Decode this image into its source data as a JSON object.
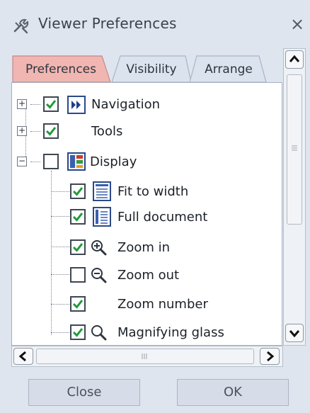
{
  "window": {
    "title": "Viewer Preferences",
    "close_glyph": "×"
  },
  "tabs": [
    {
      "label": "Preferences",
      "active": true
    },
    {
      "label": "Visibility",
      "active": false
    },
    {
      "label": "Arrange",
      "active": false
    }
  ],
  "tree": {
    "items": [
      {
        "label": "Navigation",
        "checked": true,
        "expander": "+",
        "icon": "navigation-icon"
      },
      {
        "label": "Tools",
        "checked": true,
        "expander": "+",
        "icon": ""
      },
      {
        "label": "Display",
        "checked": false,
        "expander": "−",
        "icon": "display-icon"
      },
      {
        "label": "Fit to width",
        "checked": true,
        "icon": "fit-to-width-icon"
      },
      {
        "label": "Full document",
        "checked": true,
        "icon": "full-document-icon"
      },
      {
        "label": "Zoom in",
        "checked": true,
        "icon": "zoom-in-icon"
      },
      {
        "label": "Zoom out",
        "checked": false,
        "icon": "zoom-out-icon"
      },
      {
        "label": "Zoom number",
        "checked": true,
        "icon": ""
      },
      {
        "label": "Magnifying glass",
        "checked": true,
        "icon": "magnifying-glass-icon"
      }
    ]
  },
  "scrollbars": {
    "left_glyph": "<",
    "right_glyph": ">",
    "grip_glyph": "III"
  },
  "footer": {
    "close_label": "Close",
    "ok_label": "OK"
  },
  "colors": {
    "check": "#1f9b3a",
    "active_tab": "#f0b8b4",
    "tab": "#dbe3ef",
    "panel_border": "#a7b1c0"
  }
}
